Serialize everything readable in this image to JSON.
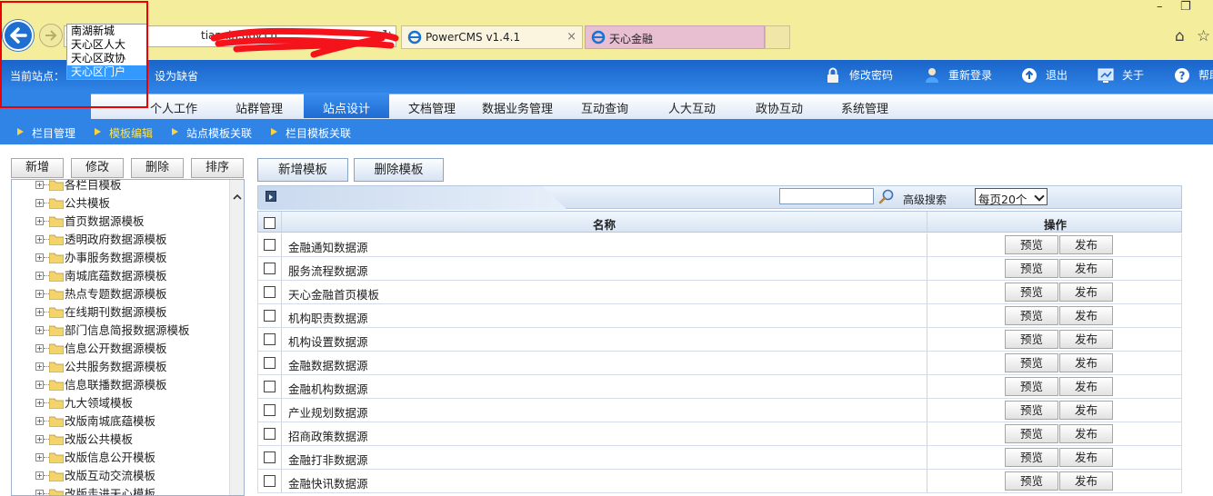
{
  "browser": {
    "address_text": "tianxin.gov.cn",
    "tabs": [
      {
        "label": "PowerCMS v1.4.1",
        "close": "×"
      },
      {
        "label": "天心金融"
      }
    ],
    "window_controls": {
      "minimize": "–",
      "restore": "❐"
    }
  },
  "site_dropdown": {
    "options": [
      "南湖新城",
      "天心区人大",
      "天心区政协",
      "天心区门户"
    ],
    "selected_index": 3
  },
  "header": {
    "current_site_label": "当前站点：",
    "current_site_value": "设为缺省",
    "links": [
      {
        "label": "修改密码",
        "icon": "lock-icon"
      },
      {
        "label": "重新登录",
        "icon": "user-icon"
      },
      {
        "label": "退出",
        "icon": "exit-icon"
      },
      {
        "label": "关于",
        "icon": "monitor-icon"
      },
      {
        "label": "帮助",
        "icon": "help-icon"
      }
    ]
  },
  "main_nav": {
    "items": [
      "个人工作",
      "站群管理",
      "站点设计",
      "文档管理",
      "数据业务管理",
      "互动查询",
      "人大互动",
      "政协互动",
      "系统管理"
    ],
    "active_index": 2
  },
  "sub_nav": {
    "items": [
      "栏目管理",
      "模板编辑",
      "站点模板关联",
      "栏目模板关联"
    ],
    "active_index": 1
  },
  "tree_toolbar": {
    "add": "新增",
    "edit": "修改",
    "delete": "删除",
    "sort": "排序"
  },
  "tree": {
    "items": [
      "各栏目模板",
      "公共模板",
      "首页数据源模板",
      "透明政府数据源模板",
      "办事服务数据源模板",
      "南城底蕴数据源模板",
      "热点专题数据源模板",
      "在线期刊数据源模板",
      "部门信息简报数据源模板",
      "信息公开数据源模板",
      "公共服务数据源模板",
      "信息联播数据源模板",
      "九大领域模板",
      "改版南城底蕴模板",
      "改版公共模板",
      "改版信息公开模板",
      "改版互动交流模板",
      "改版走进天心模板"
    ]
  },
  "template_toolbar": {
    "add_template": "新增模板",
    "delete_template": "删除模板"
  },
  "search": {
    "advanced_label": "高级搜索",
    "page_size": "每页20个"
  },
  "grid": {
    "headers": {
      "name": "名称",
      "action": "操作"
    },
    "preview_label": "预览",
    "publish_label": "发布",
    "rows": [
      "金融通知数据源",
      "服务流程数据源",
      "天心金融首页模板",
      "机构职责数据源",
      "机构设置数据源",
      "金融数据数据源",
      "金融机构数据源",
      "产业规划数据源",
      "招商政策数据源",
      "金融打非数据源",
      "金融快讯数据源"
    ]
  }
}
